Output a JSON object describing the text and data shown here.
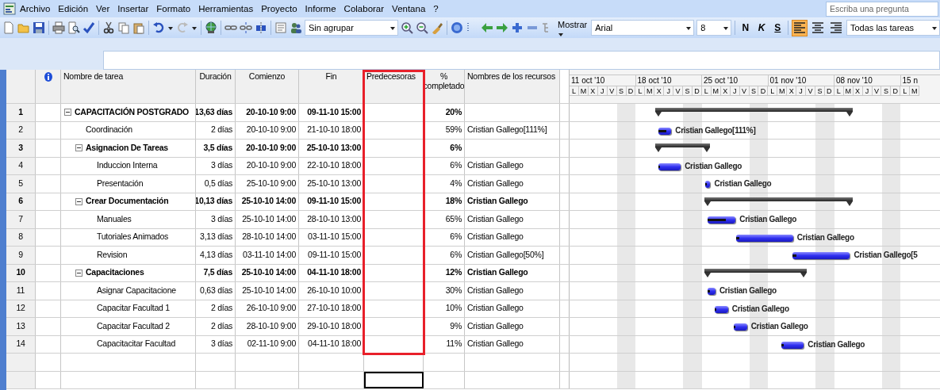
{
  "menu": [
    "Archivo",
    "Edición",
    "Ver",
    "Insertar",
    "Formato",
    "Herramientas",
    "Proyecto",
    "Informe",
    "Colaborar",
    "Ventana",
    "?"
  ],
  "search": {
    "placeholder": "Escriba una pregunta"
  },
  "toolbar": {
    "group_by": "Sin agrupar",
    "show": "Mostrar",
    "font": "Arial",
    "size": "8",
    "format_buttons": [
      {
        "label": "N",
        "selected": false
      },
      {
        "label": "K",
        "selected": false
      },
      {
        "label": "S",
        "selected": false
      }
    ],
    "align_buttons": [
      {
        "selected": true
      },
      {
        "selected": false
      },
      {
        "selected": false
      }
    ],
    "filter": "Todas las tareas"
  },
  "table": {
    "columns": [
      {
        "label": "Nombre de tarea",
        "highlighted": false
      },
      {
        "label": "Duración",
        "highlighted": false
      },
      {
        "label": "Comienzo",
        "highlighted": false
      },
      {
        "label": "Fin",
        "highlighted": false
      },
      {
        "label": "Predecesoras",
        "highlighted": true
      },
      {
        "label": "% completado",
        "highlighted": false
      },
      {
        "label": "Nombres de los recursos",
        "highlighted": false
      }
    ],
    "rows": [
      {
        "id": "1",
        "name": "CAPACITACIÓN POSTGRADO",
        "kind": "summary",
        "expanded": true,
        "duration": "13,63 días",
        "start": "20-10-10 9:00",
        "finish": "09-11-10 15:00",
        "percent": "20%",
        "children": [
          {
            "id": "2",
            "name": "Coordinación",
            "kind": "task",
            "duration": "2 días",
            "start": "20-10-10 9:00",
            "finish": "21-10-10 18:00",
            "percent": "59%",
            "resources": "Cristian Gallego[111%]",
            "bar_label": "Cristian Gallego[111%]"
          },
          {
            "id": "3",
            "name": "Asignacion De Tareas",
            "kind": "summary",
            "expanded": true,
            "duration": "3,5 días",
            "start": "20-10-10 9:00",
            "finish": "25-10-10 13:00",
            "percent": "6%",
            "children": [
              {
                "id": "4",
                "name": "Induccion Interna",
                "kind": "task",
                "duration": "3 días",
                "start": "20-10-10 9:00",
                "finish": "22-10-10 18:00",
                "percent": "6%",
                "resources": "Cristian Gallego",
                "bar_label": "Cristian Gallego"
              },
              {
                "id": "5",
                "name": "Presentación",
                "kind": "task",
                "duration": "0,5 días",
                "start": "25-10-10 9:00",
                "finish": "25-10-10 13:00",
                "percent": "4%",
                "resources": "Cristian Gallego",
                "bar_label": "Cristian Gallego"
              }
            ]
          },
          {
            "id": "6",
            "name": "Crear Documentación",
            "kind": "summary",
            "expanded": true,
            "duration": "10,13 días",
            "start": "25-10-10 14:00",
            "finish": "09-11-10 15:00",
            "percent": "18%",
            "resources": "Cristian Gallego",
            "children": [
              {
                "id": "7",
                "name": "Manuales",
                "kind": "task",
                "duration": "3 días",
                "start": "25-10-10 14:00",
                "finish": "28-10-10 13:00",
                "percent": "65%",
                "resources": "Cristian Gallego",
                "bar_label": "Cristian Gallego"
              },
              {
                "id": "8",
                "name": "Tutoriales Animados",
                "kind": "task",
                "duration": "3,13 días",
                "start": "28-10-10 14:00",
                "finish": "03-11-10 15:00",
                "percent": "6%",
                "resources": "Cristian Gallego",
                "bar_label": "Cristian Gallego"
              },
              {
                "id": "9",
                "name": "Revision",
                "kind": "task",
                "duration": "4,13 días",
                "start": "03-11-10 14:00",
                "finish": "09-11-10 15:00",
                "percent": "6%",
                "resources": "Cristian Gallego[50%]",
                "bar_label": "Cristian Gallego[5"
              }
            ]
          },
          {
            "id": "10",
            "name": "Capacitaciones",
            "kind": "summary",
            "expanded": true,
            "duration": "7,5 días",
            "start": "25-10-10 14:00",
            "finish": "04-11-10 18:00",
            "percent": "12%",
            "resources": "Cristian Gallego",
            "children": [
              {
                "id": "11",
                "name": "Asignar Capacitacione",
                "kind": "task",
                "duration": "0,63 días",
                "start": "25-10-10 14:00",
                "finish": "26-10-10 10:00",
                "percent": "30%",
                "resources": "Cristian Gallego",
                "bar_label": "Cristian Gallego"
              },
              {
                "id": "12",
                "name": "Capacitar Facultad 1",
                "kind": "task",
                "duration": "2 días",
                "start": "26-10-10 9:00",
                "finish": "27-10-10 18:00",
                "percent": "10%",
                "resources": "Cristian Gallego",
                "bar_label": "Cristian Gallego"
              },
              {
                "id": "13",
                "name": "Capacitar Facultad 2",
                "kind": "task",
                "duration": "2 días",
                "start": "28-10-10 9:00",
                "finish": "29-10-10 18:00",
                "percent": "9%",
                "resources": "Cristian Gallego",
                "bar_label": "Cristian Gallego"
              },
              {
                "id": "14",
                "name": "Capacitacitar Facultad",
                "kind": "task",
                "duration": "3 días",
                "start": "02-11-10 9:00",
                "finish": "04-11-10 18:00",
                "percent": "11%",
                "resources": "Cristian Gallego",
                "bar_label": "Cristian Gallego"
              }
            ]
          }
        ]
      }
    ],
    "blank_rows": [
      {
        "selected": false
      },
      {
        "selected": true
      }
    ]
  },
  "timeline": {
    "weeks": [
      "11 oct '10",
      "18 oct '10",
      "25 oct '10",
      "01 nov '10",
      "08 nov '10",
      "15 n"
    ],
    "days": [
      "L",
      "M",
      "X",
      "J",
      "V",
      "S",
      "D",
      "L",
      "M",
      "X",
      "J",
      "V",
      "S",
      "D",
      "L",
      "M",
      "X",
      "J",
      "V",
      "S",
      "D",
      "L",
      "M",
      "X",
      "J",
      "V",
      "S",
      "D",
      "L",
      "M",
      "X",
      "J",
      "V",
      "S",
      "D",
      "L",
      "M"
    ]
  }
}
